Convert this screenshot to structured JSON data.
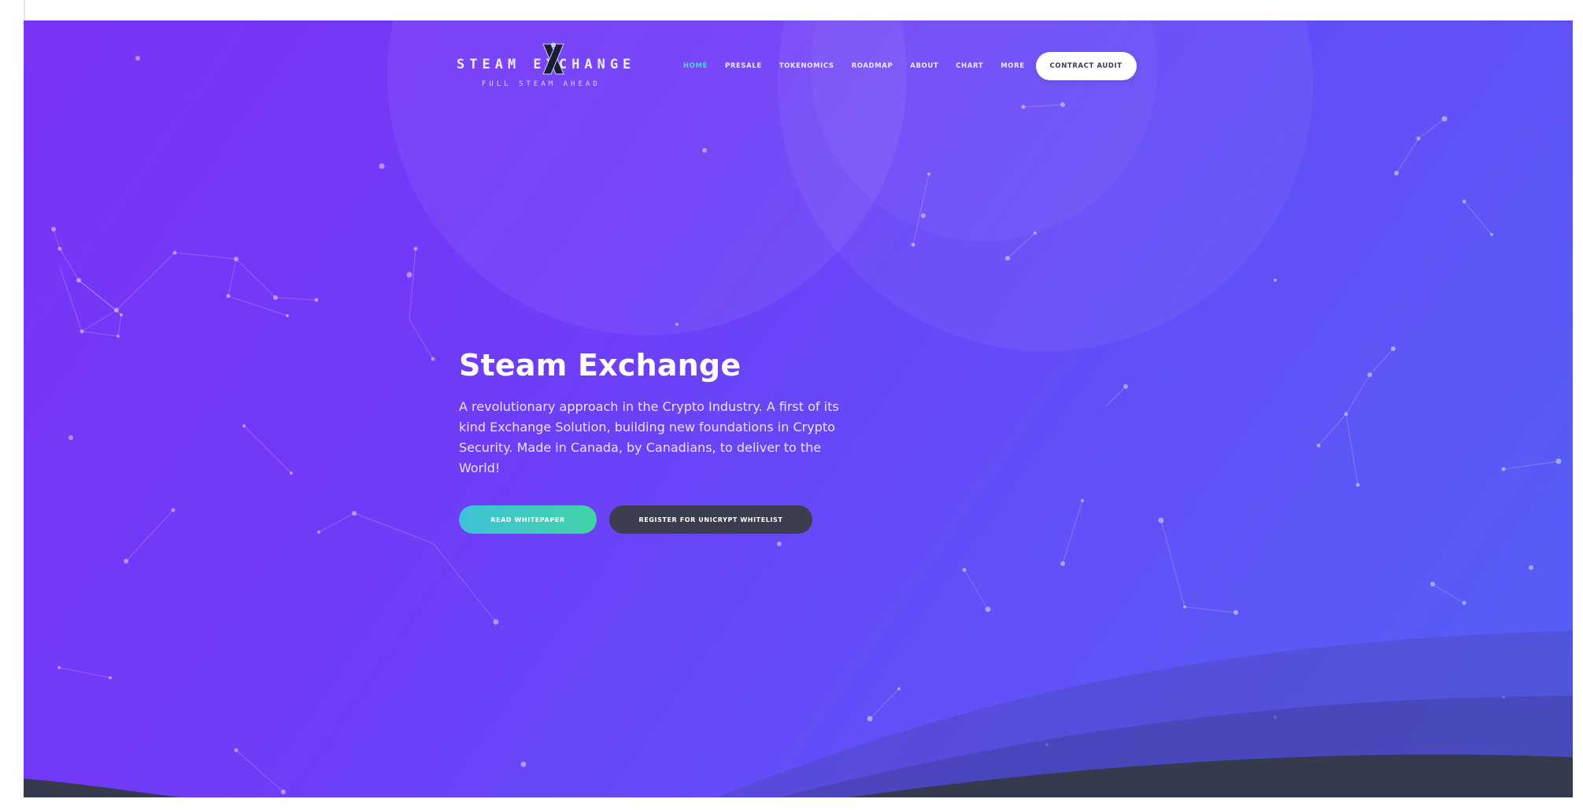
{
  "brand": {
    "name": "STEAM EXCHANGE",
    "tagline": "FULL STEAM AHEAD"
  },
  "nav": {
    "items": [
      {
        "label": "HOME",
        "active": true
      },
      {
        "label": "PRESALE"
      },
      {
        "label": "TOKENOMICS"
      },
      {
        "label": "ROADMAP"
      },
      {
        "label": "ABOUT"
      },
      {
        "label": "CHART"
      },
      {
        "label": "MORE"
      }
    ],
    "cta": "CONTRACT AUDIT"
  },
  "hero": {
    "title": "Steam Exchange",
    "description": "A revolutionary approach in the Crypto Industry. A first of its kind Exchange Solution, building new foundations in Crypto Security. Made in Canada, by Canadians, to deliver to the World!",
    "primary_button": "READ WHITEPAPER",
    "secondary_button": "REGISTER FOR UNICRYPT WHITELIST"
  },
  "colors": {
    "gradient_start": "#7a33f7",
    "gradient_end": "#5560f4",
    "active_nav": "#4fd6c8",
    "primary_button": "#42d3a7",
    "secondary_button": "#3c3d4e",
    "wave_dark": "#353a4c"
  },
  "icons": {
    "logo_mark": "x-letter-logo-icon"
  }
}
